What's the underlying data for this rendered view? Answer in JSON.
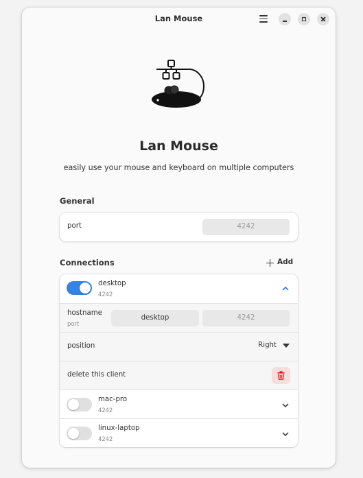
{
  "window": {
    "title": "Lan Mouse",
    "menu_icon": "hamburger-menu-icon",
    "minimize_icon": "minimize-icon",
    "maximize_icon": "maximize-icon",
    "close_icon": "close-icon"
  },
  "header": {
    "logo_icon": "lan-mouse-logo-icon",
    "title": "Lan Mouse",
    "subtitle": "easily use your mouse and keyboard on multiple computers"
  },
  "general": {
    "heading": "General",
    "port_label": "port",
    "port_placeholder": "4242"
  },
  "connections": {
    "heading": "Connections",
    "add_label": "Add",
    "add_icon": "plus-icon",
    "clients": [
      {
        "name": "desktop",
        "port": "4242",
        "enabled": true,
        "expanded": true,
        "hostname_label": "hostname",
        "hostname_sublabel": "port",
        "hostname_value": "desktop",
        "port_placeholder": "4242",
        "position_label": "position",
        "position_value": "Right",
        "delete_label": "delete this client",
        "delete_icon": "trash-icon"
      },
      {
        "name": "mac-pro",
        "port": "4242",
        "enabled": false,
        "expanded": false
      },
      {
        "name": "linux-laptop",
        "port": "4242",
        "enabled": false,
        "expanded": false
      }
    ]
  },
  "colors": {
    "accent": "#3584e4",
    "destructive": "#e01b24",
    "destructive_bg": "#f6dede"
  }
}
